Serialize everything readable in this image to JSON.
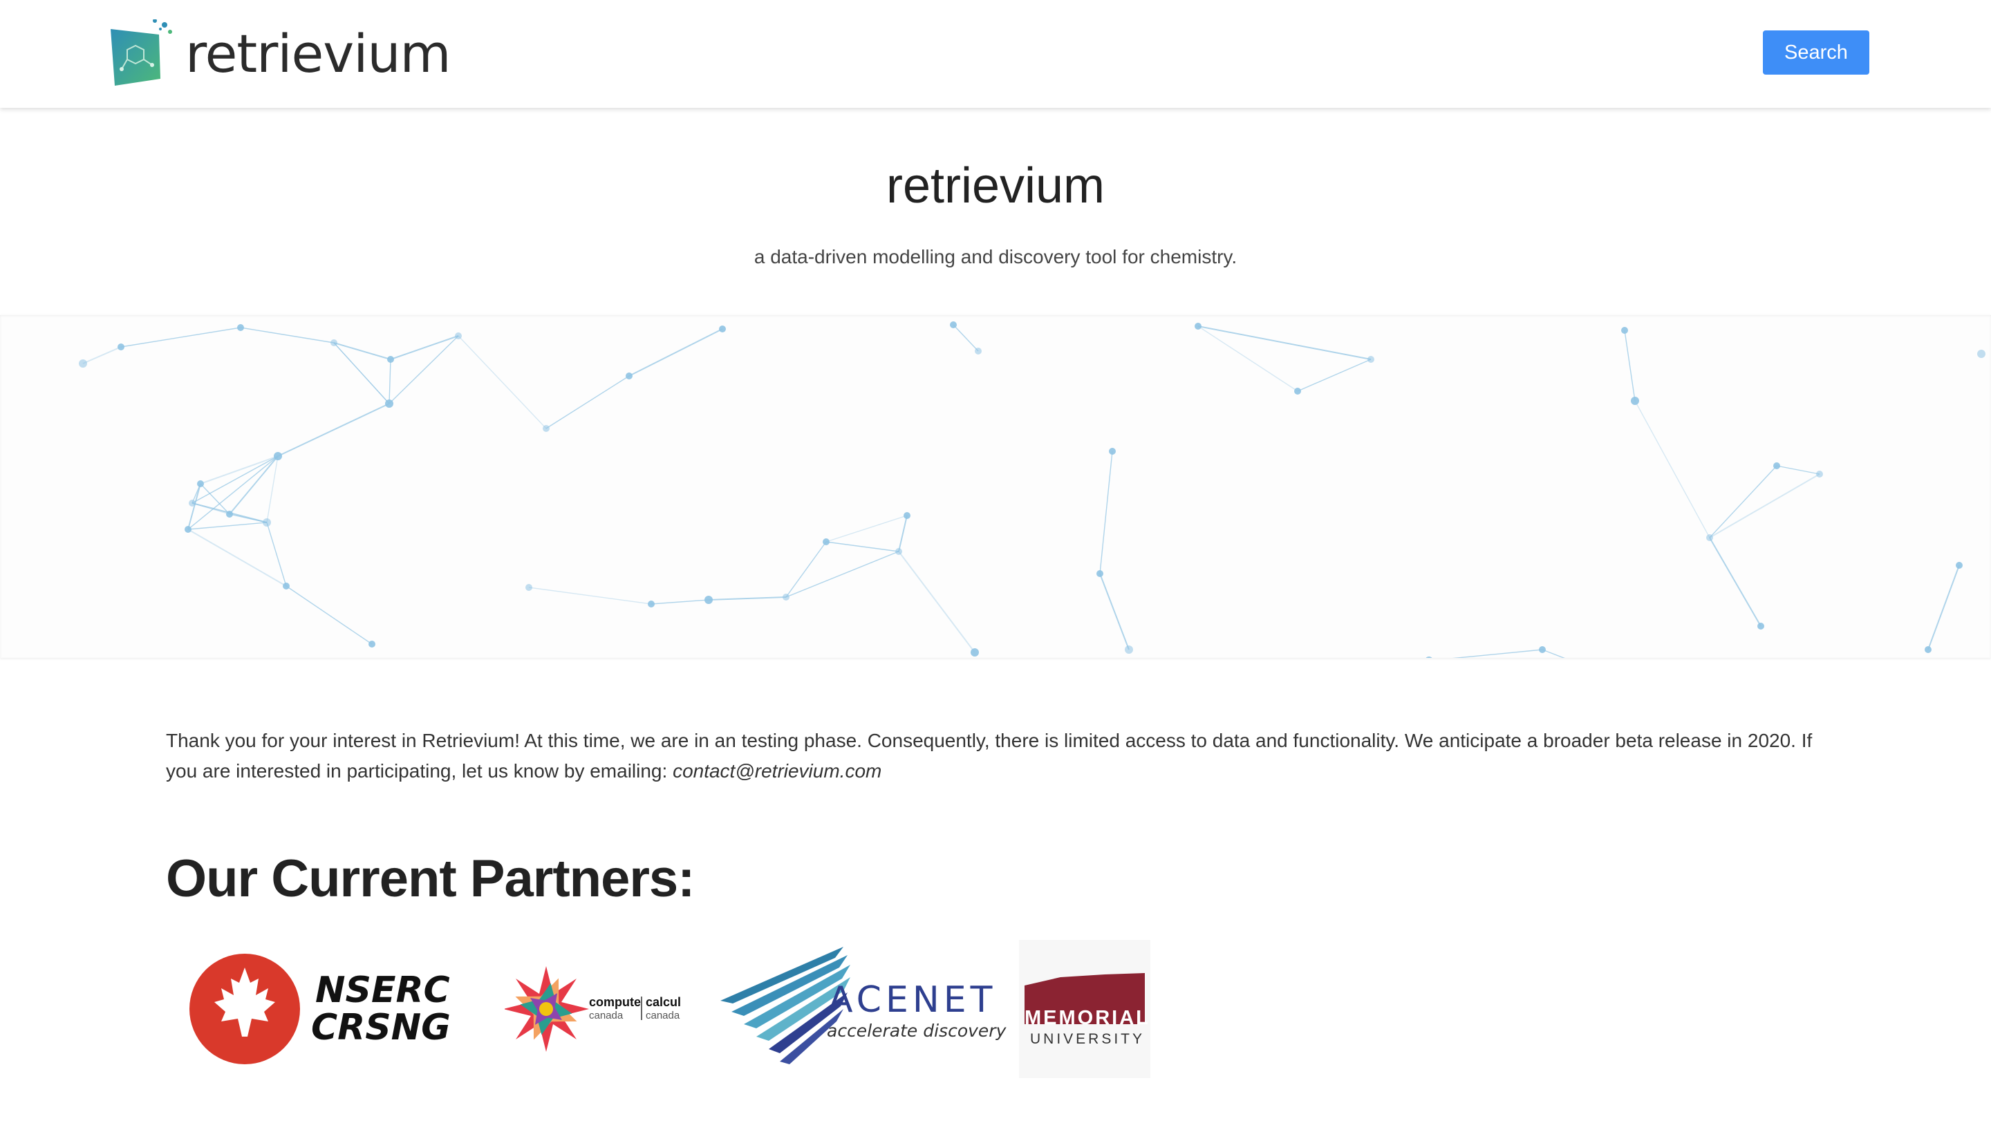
{
  "navbar": {
    "brand_name": "retrievium",
    "search_label": "Search"
  },
  "hero": {
    "title": "retrievium",
    "subtitle": "a data-driven modelling and discovery tool for chemistry."
  },
  "intro": {
    "text": "Thank you for your interest in Retrievium! At this time, we are in an testing phase. Consequently, there is limited access to data and functionality. We anticipate a broader beta release in 2020. If you are interested in participating, let us know by emailing: ",
    "email": "contact@retrievium.com"
  },
  "partners": {
    "title": "Our Current Partners:",
    "logos": [
      {
        "name": "NSERC CRSNG",
        "line1": "NSERC",
        "line2": "CRSNG"
      },
      {
        "name": "Compute Canada",
        "word1": "compute",
        "word2": "canada",
        "word3": "calcul",
        "word4": "canada"
      },
      {
        "name": "ACENET",
        "title": "ACENET",
        "tagline": "accelerate discovery"
      },
      {
        "name": "Memorial University",
        "line1": "MEMORIAL",
        "line2": "UNIVERSITY"
      }
    ]
  },
  "colors": {
    "accent": "#3e8ef7",
    "network_node": "#8fc3e3",
    "nserc_red": "#d9392b",
    "acenet_blue": "#2e3f8f",
    "memorial_maroon": "#8b2332"
  },
  "icons": {
    "brand_logo": "molecule-hexagon-icon",
    "nserc_logo": "maple-leaf-icon",
    "compute_logo": "starburst-icon",
    "acenet_logo": "stripes-icon"
  }
}
